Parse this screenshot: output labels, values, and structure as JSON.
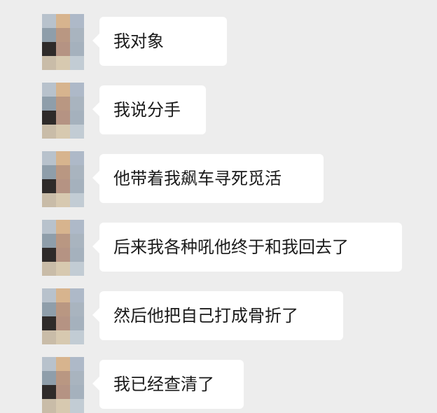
{
  "messages": [
    {
      "text": "我对象"
    },
    {
      "text": "我说分手"
    },
    {
      "text": "他带着我飙车寻死觅活"
    },
    {
      "text": "后来我各种吼他终于和我回去了"
    },
    {
      "text": "然后他把自己打成骨折了"
    },
    {
      "text": "我已经查清了"
    }
  ],
  "avatar_colors": {
    "pixels": [
      "#b8c2cc",
      "#d7b48e",
      "#aeb9c8",
      "#8f9eaa",
      "#b99782",
      "#a9b4bf",
      "#2f2b2a",
      "#b59383",
      "#a5b1bd",
      "#c9bca8",
      "#d7c9b0",
      "#c2ccd4"
    ]
  },
  "colors": {
    "background": "#ededed",
    "bubble": "#ffffff",
    "text": "#1a1a1a"
  }
}
